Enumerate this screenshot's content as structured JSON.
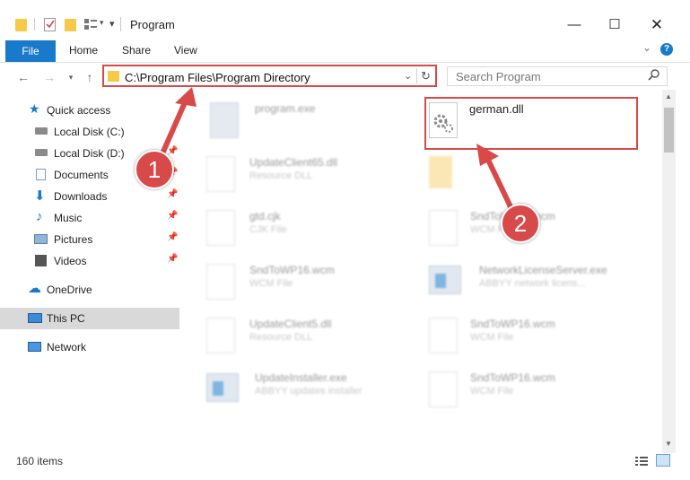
{
  "window": {
    "title": "Program",
    "controls": [
      "minimize",
      "maximize",
      "close"
    ]
  },
  "ribbon": {
    "tabs": [
      {
        "label": "File",
        "active": true
      },
      {
        "label": "Home"
      },
      {
        "label": "Share"
      },
      {
        "label": "View"
      }
    ]
  },
  "address_bar": {
    "path": "C:\\Program Files\\Program Directory",
    "search_placeholder": "Search Program"
  },
  "sidebar": {
    "items": [
      {
        "label": "Quick access",
        "icon": "star-icon"
      },
      {
        "label": "Local Disk (C:)",
        "icon": "drive-icon"
      },
      {
        "label": "Local Disk (D:)",
        "icon": "drive-icon",
        "pinned": true
      },
      {
        "label": "Documents",
        "icon": "documents-icon",
        "pinned": true
      },
      {
        "label": "Downloads",
        "icon": "downloads-icon",
        "pinned": true
      },
      {
        "label": "Music",
        "icon": "music-icon",
        "pinned": true
      },
      {
        "label": "Pictures",
        "icon": "pictures-icon",
        "pinned": true
      },
      {
        "label": "Videos",
        "icon": "videos-icon",
        "pinned": true
      },
      {
        "label": "OneDrive",
        "icon": "cloud-icon"
      },
      {
        "label": "This PC",
        "icon": "pc-icon",
        "selected": true
      },
      {
        "label": "Network",
        "icon": "network-icon"
      }
    ]
  },
  "files": [
    {
      "name": "program.exe",
      "desc": "",
      "icon": "exe-icon"
    },
    {
      "name": "german.dll",
      "desc": "",
      "icon": "dll-gear-icon",
      "highlighted": true
    },
    {
      "name": "UpdateClient65.dll",
      "desc": "Resource DLL",
      "icon": "dll-gear-icon"
    },
    {
      "name": "",
      "desc": "",
      "icon": "folder-icon"
    },
    {
      "name": "gtd.cjk",
      "desc": "CJK File",
      "icon": "file-icon"
    },
    {
      "name": "SndToWP16.wcm",
      "desc": "WCM File",
      "icon": "file-icon"
    },
    {
      "name": "SndToWP16.wcm",
      "desc": "WCM File",
      "icon": "file-icon"
    },
    {
      "name": "NetworkLicenseServer.exe",
      "desc": "ABBYY network licens...",
      "icon": "exe-icon"
    },
    {
      "name": "UpdateClient5.dll",
      "desc": "Resource DLL",
      "icon": "dll-gear-icon"
    },
    {
      "name": "SndToWP16.wcm",
      "desc": "WCM File",
      "icon": "file-icon"
    },
    {
      "name": "UpdateInstaller.exe",
      "desc": "ABBYY updates installer",
      "icon": "exe-icon"
    },
    {
      "name": "SndToWP16.wcm",
      "desc": "WCM File",
      "icon": "file-icon"
    }
  ],
  "status_bar": {
    "item_count": "160 items"
  },
  "annotations": {
    "step1": "1",
    "step2": "2",
    "accent_color": "#d84a4a"
  }
}
